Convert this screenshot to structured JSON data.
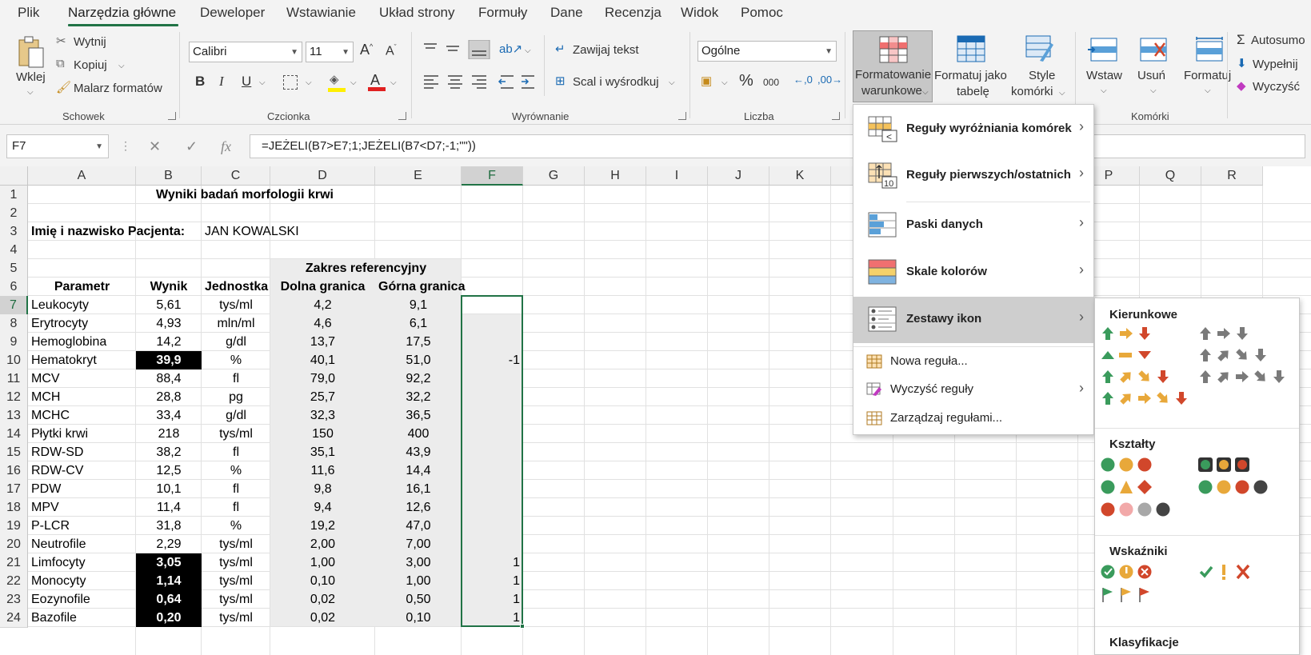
{
  "tabs": [
    "Plik",
    "Narzędzia główne",
    "Deweloper",
    "Wstawianie",
    "Układ strony",
    "Formuły",
    "Dane",
    "Recenzja",
    "Widok",
    "Pomoc"
  ],
  "active_tab": "Narzędzia główne",
  "ribbon": {
    "clipboard": {
      "paste": "Wklej",
      "cut": "Wytnij",
      "copy": "Kopiuj",
      "painter": "Malarz formatów",
      "group": "Schowek"
    },
    "font": {
      "name": "Calibri",
      "size": "11",
      "group": "Czcionka",
      "bold": "B",
      "italic": "I",
      "underline": "U"
    },
    "alignment": {
      "wrap": "Zawijaj tekst",
      "merge": "Scal i wyśrodkuj",
      "group": "Wyrównanie"
    },
    "number": {
      "format": "Ogólne",
      "percent": "%",
      "thousands": "000",
      "group": "Liczba"
    },
    "styles": {
      "cf_line1": "Formatowanie",
      "cf_line2": "warunkowe",
      "table_line1": "Formatuj jako",
      "table_line2": "tabelę",
      "cell_line1": "Style",
      "cell_line2": "komórki"
    },
    "cells": {
      "insert": "Wstaw",
      "delete": "Usuń",
      "format": "Formatuj",
      "group": "Komórki"
    },
    "editing": {
      "autosum": "Autosumo",
      "fill": "Wypełnij",
      "clear": "Wyczyść"
    }
  },
  "formula_bar": {
    "name_box": "F7",
    "formula": "=JEŻELI(B7>E7;1;JEŻELI(B7<D7;-1;\"\"))",
    "fx": "fx"
  },
  "columns": [
    "A",
    "B",
    "C",
    "D",
    "E",
    "F",
    "G",
    "H",
    "I",
    "J",
    "K",
    "P",
    "Q",
    "R"
  ],
  "rows": [
    "1",
    "2",
    "3",
    "4",
    "5",
    "6",
    "7",
    "8",
    "9",
    "10",
    "11",
    "12",
    "13",
    "14",
    "15",
    "16",
    "17",
    "18",
    "19",
    "20",
    "21",
    "22",
    "23",
    "24"
  ],
  "sheet": {
    "title": "Wyniki badań morfologii krwi",
    "patient_label": "Imię i nazwisko Pacjenta:",
    "patient_name": "JAN KOWALSKI",
    "ref_header": "Zakres referencyjny",
    "headers": [
      "Parametr",
      "Wynik",
      "Jednostka",
      "Dolna granica",
      "Górna granica"
    ],
    "data": [
      [
        "Leukocyty",
        "5,61",
        "tys/ml",
        "4,2",
        "9,1",
        ""
      ],
      [
        "Erytrocyty",
        "4,93",
        "mln/ml",
        "4,6",
        "6,1",
        ""
      ],
      [
        "Hemoglobina",
        "14,2",
        "g/dl",
        "13,7",
        "17,5",
        ""
      ],
      [
        "Hematokryt",
        "39,9",
        "%",
        "40,1",
        "51,0",
        "-1"
      ],
      [
        "MCV",
        "88,4",
        "fl",
        "79,0",
        "92,2",
        ""
      ],
      [
        "MCH",
        "28,8",
        "pg",
        "25,7",
        "32,2",
        ""
      ],
      [
        "MCHC",
        "33,4",
        "g/dl",
        "32,3",
        "36,5",
        ""
      ],
      [
        "Płytki krwi",
        "218",
        "tys/ml",
        "150",
        "400",
        ""
      ],
      [
        "RDW-SD",
        "38,2",
        "fl",
        "35,1",
        "43,9",
        ""
      ],
      [
        "RDW-CV",
        "12,5",
        "%",
        "11,6",
        "14,4",
        ""
      ],
      [
        "PDW",
        "10,1",
        "fl",
        "9,8",
        "16,1",
        ""
      ],
      [
        "MPV",
        "11,4",
        "fl",
        "9,4",
        "12,6",
        ""
      ],
      [
        "P-LCR",
        "31,8",
        "%",
        "19,2",
        "47,0",
        ""
      ],
      [
        "Neutrofile",
        "2,29",
        "tys/ml",
        "2,00",
        "7,00",
        ""
      ],
      [
        "Limfocyty",
        "3,05",
        "tys/ml",
        "1,00",
        "3,00",
        "1"
      ],
      [
        "Monocyty",
        "1,14",
        "tys/ml",
        "0,10",
        "1,00",
        "1"
      ],
      [
        "Eozynofile",
        "0,64",
        "tys/ml",
        "0,02",
        "0,50",
        "1"
      ],
      [
        "Bazofile",
        "0,20",
        "tys/ml",
        "0,02",
        "0,10",
        "1"
      ]
    ],
    "highlighted_rows": [
      "Hematokryt",
      "Limfocyty",
      "Monocyty",
      "Eozynofile",
      "Bazofile"
    ]
  },
  "cf_menu": {
    "items": [
      "Reguły wyróżniania komórek",
      "Reguły pierwszych/ostatnich",
      "Paski danych",
      "Skale kolorów",
      "Zestawy ikon"
    ],
    "new_rule": "Nowa reguła...",
    "clear_rules": "Wyczyść reguły",
    "manage_rules": "Zarządzaj regułami...",
    "active_item": "Zestawy ikon"
  },
  "icon_sets": {
    "sections": [
      "Kierunkowe",
      "Kształty",
      "Wskaźniki",
      "Klasyfikacje"
    ]
  },
  "colors": {
    "accent": "#217346",
    "green": "#3a9b5c",
    "yellow": "#e8a83a",
    "red": "#d1472b",
    "gray": "#7a7a7a"
  }
}
